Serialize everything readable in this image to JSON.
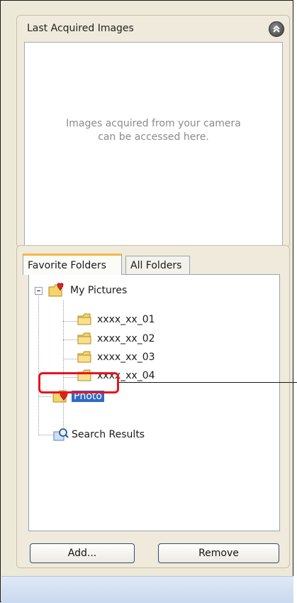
{
  "last_acquired": {
    "title": "Last Acquired Images",
    "message": "Images acquired from your camera can be accessed here.",
    "collapse_icon": "double-chevron-up-icon"
  },
  "tabs": [
    {
      "label": "Favorite Folders",
      "active": true
    },
    {
      "label": "All Folders",
      "active": false
    }
  ],
  "tree": {
    "root": {
      "label": "My Pictures",
      "icon": "favorite-folder-icon",
      "expanded": true
    },
    "children": [
      {
        "label": "xxxx_xx_01",
        "icon": "folder-icon"
      },
      {
        "label": "xxxx_xx_02",
        "icon": "folder-icon"
      },
      {
        "label": "xxxx_xx_03",
        "icon": "folder-icon"
      },
      {
        "label": "xxxx_xx_04",
        "icon": "folder-icon"
      }
    ],
    "selected": {
      "label": "Photo",
      "icon": "favorite-folder-icon"
    },
    "search": {
      "label": "Search Results",
      "icon": "search-results-icon"
    }
  },
  "buttons": {
    "add_label": "Add...",
    "remove_label": "Remove"
  },
  "colors": {
    "selection": "#316ac5",
    "callout": "#e8141c",
    "folder": "#f5d468"
  }
}
